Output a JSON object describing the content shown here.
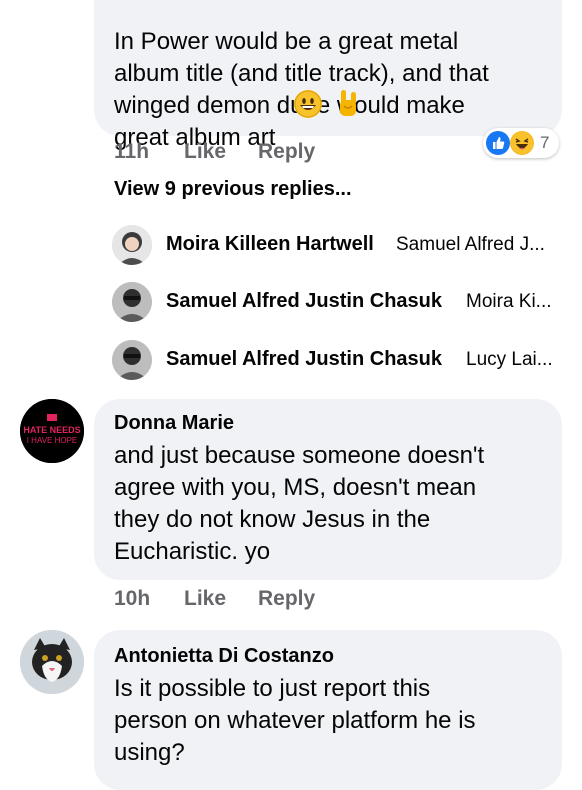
{
  "comments": [
    {
      "text": "In Power would be a great metal\nalbum title (and title track), and that\nwinged demon dude would make\ngreat album art",
      "time": "11h",
      "like": "Like",
      "reply": "Reply",
      "reaction_count": "7",
      "reaction_icons": [
        "like-icon",
        "haha-icon"
      ],
      "emojis": [
        "grinning-face-emoji",
        "sign-of-horns-emoji"
      ]
    },
    {
      "author": "Donna Marie",
      "avatar_text_top": "HATE NEEDS",
      "avatar_text_bottom": "I HAVE HOPE",
      "text": "and just because someone doesn't\nagree with you, MS, doesn't mean\nthey do not know Jesus in the\nEucharistic. yo",
      "time": "10h",
      "like": "Like",
      "reply": "Reply"
    },
    {
      "author": "Antonietta Di Costanzo",
      "text": "Is it possible to just report this\nperson on whatever platform he is\nusing?"
    }
  ],
  "view_previous": "View 9 previous replies...",
  "replies": [
    {
      "name": "Moira Killeen Hartwell",
      "snippet": "Samuel Alfred J..."
    },
    {
      "name": "Samuel Alfred Justin Chasuk",
      "snippet": "Moira Ki..."
    },
    {
      "name": "Samuel Alfred Justin Chasuk",
      "snippet": "Lucy Lai..."
    }
  ],
  "colors": {
    "bubble": "#f0f2f5",
    "meta_text": "#65676b",
    "like_blue": "#1877f2",
    "haha_yellow": "#f7b928",
    "avatar_dark": "#000000",
    "avatar_pink": "#e0245e"
  }
}
